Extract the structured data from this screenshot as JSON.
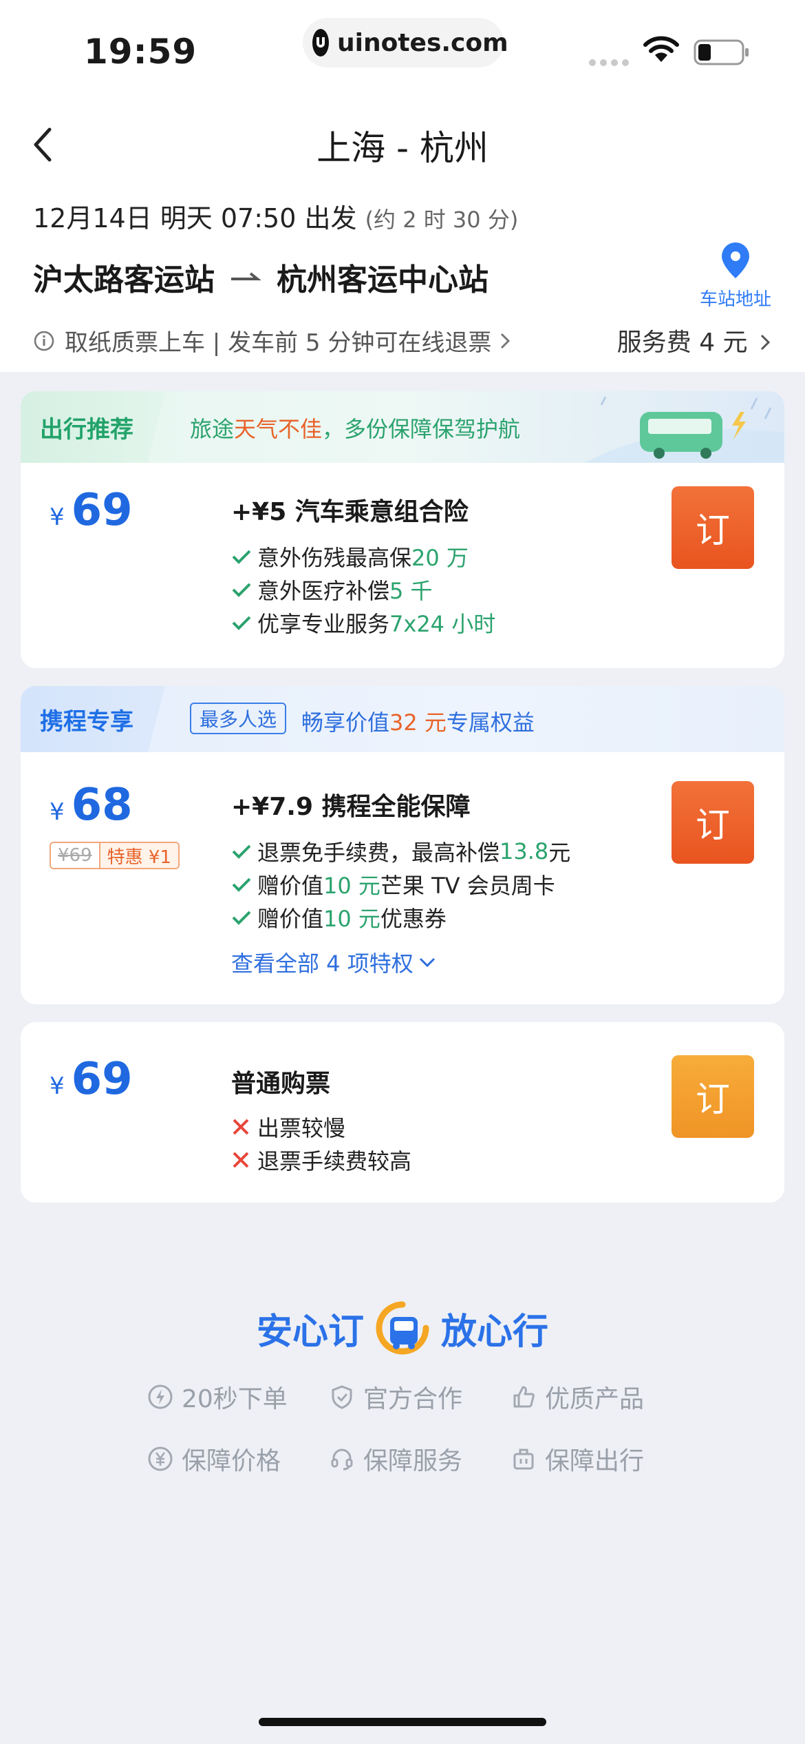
{
  "status_bar": {
    "time": "19:59",
    "url": "uinotes.com"
  },
  "header": {
    "title": "上海 - 杭州",
    "date": "12月14日 明天 07:50 出发",
    "duration": "(约 2 时 30 分)",
    "from_station": "沪太路客运站",
    "to_station": "杭州客运中心站",
    "station_address_label": "车站地址",
    "notice": "取纸质票上车 | 发车前 5 分钟可在线退票",
    "service_fee": "服务费 4 元"
  },
  "cards": [
    {
      "tag": "出行推荐",
      "banner_text_pre": "旅途",
      "banner_text_warn": "天气不佳",
      "banner_text_post": "，多份保障保驾护航",
      "currency": "¥",
      "price": "69",
      "plan": "+¥5 汽车乘意组合险",
      "features": [
        {
          "text": "意外伤残最高保 ",
          "highlight": "20 万",
          "suffix": ""
        },
        {
          "text": "意外医疗补偿 ",
          "highlight": "5 千",
          "suffix": ""
        },
        {
          "text": "优享专业服务 ",
          "highlight": "7x24 小时",
          "suffix": ""
        }
      ],
      "book": "订"
    },
    {
      "tag": "携程专享",
      "hot_pill": "最多人选",
      "banner_text_pre": "畅享价值",
      "banner_text_hl": "32 元",
      "banner_text_post": "专属权益",
      "currency": "¥",
      "price": "68",
      "original_price": "¥69",
      "discount": "特惠 ¥1",
      "plan": "+¥7.9 携程全能保障",
      "features": [
        {
          "text": "退票免手续费，最高补偿 ",
          "highlight": "13.8",
          "suffix": " 元"
        },
        {
          "text": "赠价值 ",
          "highlight": "10 元",
          "suffix": "芒果 TV 会员周卡"
        },
        {
          "text": "赠价值 ",
          "highlight": "10 元",
          "suffix": "优惠券"
        }
      ],
      "view_all": "查看全部 4 项特权",
      "book": "订"
    },
    {
      "currency": "¥",
      "price": "69",
      "plan": "普通购票",
      "features": [
        {
          "text": "出票较慢"
        },
        {
          "text": "退票手续费较高"
        }
      ],
      "book": "订"
    }
  ],
  "brand": {
    "left": "安心订",
    "right": "放心行",
    "items": [
      {
        "label": "20秒下单",
        "icon": "lightning-icon"
      },
      {
        "label": "官方合作",
        "icon": "shield-check-icon"
      },
      {
        "label": "优质产品",
        "icon": "thumbs-up-icon"
      },
      {
        "label": "保障价格",
        "icon": "yuan-icon"
      },
      {
        "label": "保障服务",
        "icon": "headset-icon"
      },
      {
        "label": "保障出行",
        "icon": "luggage-icon"
      }
    ]
  },
  "colors": {
    "accent_blue": "#1f68e0",
    "accent_green": "#2ba36e",
    "book_orange": "#e9541f",
    "book_yellow": "#f09426",
    "warn_orange": "#e8632a"
  }
}
